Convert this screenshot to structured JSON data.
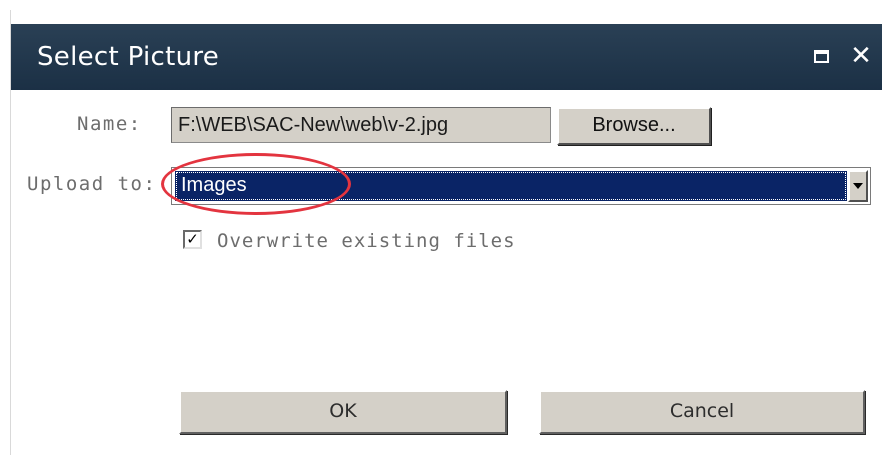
{
  "window": {
    "title": "Select Picture",
    "maximize_icon": "maximize-icon",
    "close_icon": "close-icon",
    "close_glyph": "✕"
  },
  "form": {
    "name_label": "Name:",
    "name_value": "F:\\WEB\\SAC-New\\web\\v-2.jpg",
    "browse_label": "Browse...",
    "upload_label": "Upload to:",
    "upload_selected": "Images",
    "overwrite_label": "Overwrite existing files",
    "overwrite_checked": true
  },
  "buttons": {
    "ok_label": "OK",
    "cancel_label": "Cancel"
  },
  "colors": {
    "titlebar": "#22384d",
    "selection": "#0a2466",
    "annotation": "#e3343f",
    "button_face": "#d4d0c8"
  }
}
